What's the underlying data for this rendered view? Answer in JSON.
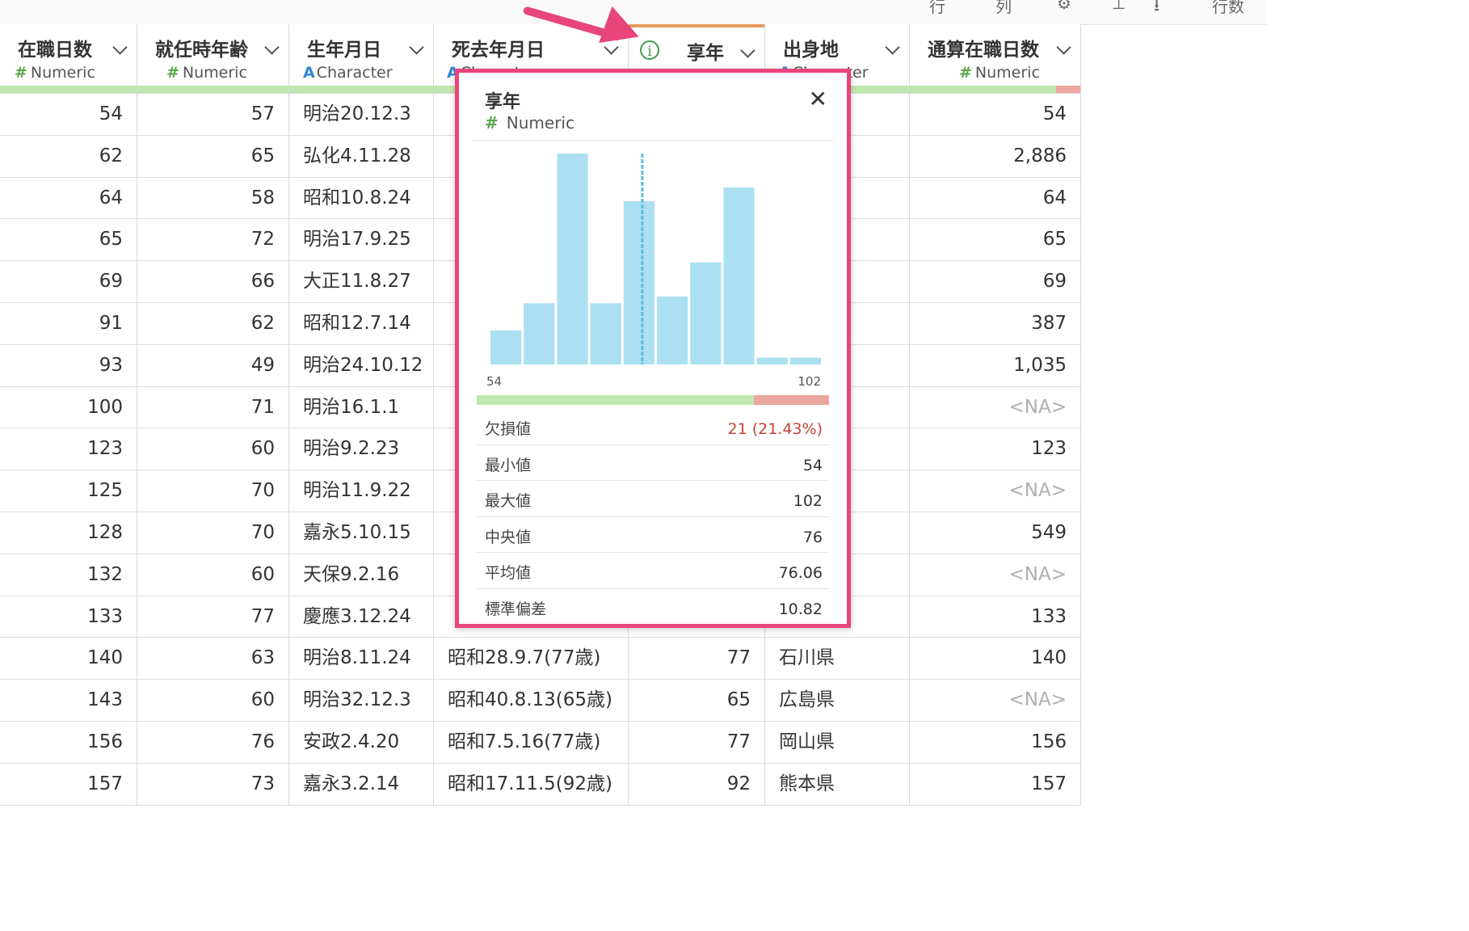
{
  "toolbar": {
    "items": [
      "行",
      "列",
      "⚙",
      "⊥",
      "⭳",
      "行数"
    ]
  },
  "columns": [
    {
      "name": "在職日数",
      "type": "Numeric",
      "align": "num",
      "missing_fraction": 0
    },
    {
      "name": "就任時年齢",
      "type": "Numeric",
      "align": "num",
      "missing_fraction": 0
    },
    {
      "name": "生年月日",
      "type": "Character",
      "align": "txt",
      "missing_fraction": 0
    },
    {
      "name": "死去年月日",
      "type": "Character",
      "align": "txt",
      "missing_fraction": 0
    },
    {
      "name": "享年",
      "type": "Numeric",
      "align": "num",
      "missing_fraction": 0
    },
    {
      "name": "出身地",
      "type": "Character",
      "align": "txt",
      "missing_fraction": 0
    },
    {
      "name": "通算在職日数",
      "type": "Numeric",
      "align": "num",
      "missing_fraction": 0.14
    }
  ],
  "rows": [
    [
      "54",
      "57",
      "明治20.12.3",
      "",
      "",
      "",
      "54"
    ],
    [
      "62",
      "65",
      "弘化4.11.28",
      "",
      "",
      "",
      "2,886"
    ],
    [
      "64",
      "58",
      "昭和10.8.24",
      "",
      "",
      "",
      "64"
    ],
    [
      "65",
      "72",
      "明治17.9.25",
      "",
      "",
      "",
      "65"
    ],
    [
      "69",
      "66",
      "大正11.8.27",
      "",
      "",
      "",
      "69"
    ],
    [
      "91",
      "62",
      "昭和12.7.14",
      "",
      "",
      "",
      "387"
    ],
    [
      "93",
      "49",
      "明治24.10.12",
      "",
      "",
      "",
      "1,035"
    ],
    [
      "100",
      "71",
      "明治16.1.1",
      "",
      "",
      "",
      "<NA>"
    ],
    [
      "123",
      "60",
      "明治9.2.23",
      "",
      "",
      "",
      "123"
    ],
    [
      "125",
      "70",
      "明治11.9.22",
      "",
      "",
      "",
      "<NA>"
    ],
    [
      "128",
      "70",
      "嘉永5.10.15",
      "",
      "",
      "",
      "549"
    ],
    [
      "132",
      "60",
      "天保9.2.16",
      "",
      "",
      "",
      "<NA>"
    ],
    [
      "133",
      "77",
      "慶應3.12.24",
      "",
      "",
      "",
      "133"
    ],
    [
      "140",
      "63",
      "明治8.11.24",
      "昭和28.9.7(77歳)",
      "77",
      "石川県",
      "140"
    ],
    [
      "143",
      "60",
      "明治32.12.3",
      "昭和40.8.13(65歳)",
      "65",
      "広島県",
      "<NA>"
    ],
    [
      "156",
      "76",
      "安政2.4.20",
      "昭和7.5.16(77歳)",
      "77",
      "岡山県",
      "156"
    ],
    [
      "157",
      "73",
      "嘉永3.2.14",
      "昭和17.11.5(92歳)",
      "92",
      "熊本県",
      "157"
    ]
  ],
  "popup": {
    "title": "享年",
    "type": "Numeric",
    "close_label": "✕",
    "x_min_label": "54",
    "x_max_label": "102",
    "missing_fraction": 0.2143,
    "stats": [
      {
        "label": "欠損値",
        "value": "21 (21.43%)",
        "highlight": true
      },
      {
        "label": "最小値",
        "value": "54",
        "highlight": false
      },
      {
        "label": "最大値",
        "value": "102",
        "highlight": false
      },
      {
        "label": "中央値",
        "value": "76",
        "highlight": false
      },
      {
        "label": "平均値",
        "value": "76.06",
        "highlight": false
      },
      {
        "label": "標準偏差",
        "value": "10.82",
        "highlight": false
      }
    ]
  },
  "chart_data": {
    "type": "bar",
    "title": "",
    "xlim": [
      54,
      102
    ],
    "values": [
      5,
      9,
      31,
      9,
      24,
      10,
      15,
      26,
      1,
      1
    ],
    "median": 76,
    "bar_color": "#acdff2",
    "median_color": "#5bbde3"
  },
  "colors": {
    "accent_pink": "#e8457a",
    "numeric_green": "#5aa64a",
    "character_blue": "#2f86d6",
    "valid_bar": "#bde9ae",
    "missing_bar": "#eba6a0",
    "selected_col_top": "#e89a5e"
  }
}
